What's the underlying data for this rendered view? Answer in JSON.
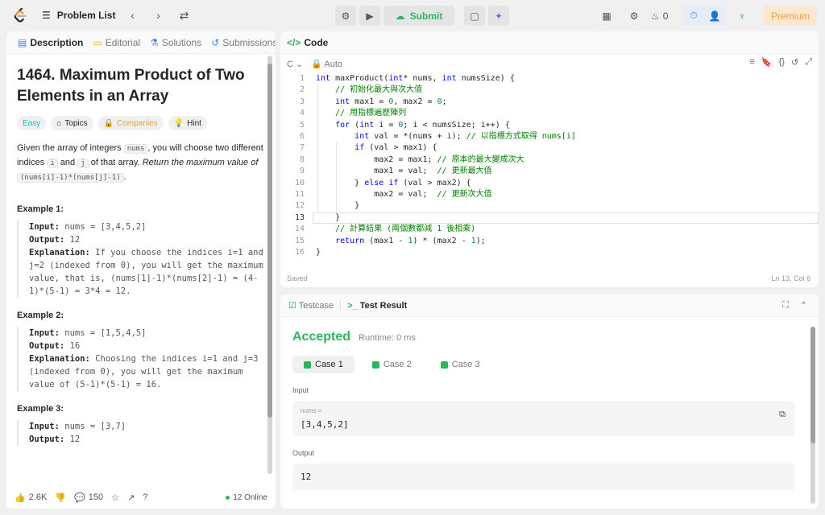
{
  "topbar": {
    "problem_list": "Problem List",
    "submit": "Submit",
    "streak": "0",
    "premium": "Premium"
  },
  "left": {
    "tabs": [
      "Description",
      "Editorial",
      "Solutions",
      "Submissions"
    ],
    "title": "1464. Maximum Product of Two Elements in an Array",
    "tags": {
      "easy": "Easy",
      "topics": "Topics",
      "companies": "Companies",
      "hint": "Hint"
    },
    "desc_p1": "Given the array of integers",
    "desc_code1": "nums",
    "desc_p2": ", you will choose two different indices",
    "desc_code2": "i",
    "desc_p3": "and",
    "desc_code3": "j",
    "desc_p4": "of that array.",
    "desc_em": "Return the maximum value of",
    "desc_code4": "(nums[i]-1)*(nums[j]-1)",
    "desc_end": ".",
    "examples": [
      {
        "h": "Example 1:",
        "input": "nums = [3,4,5,2]",
        "output": "12",
        "expl": "If you choose the indices i=1 and j=2 (indexed from 0), you will get the maximum value, that is, (nums[1]-1)*(nums[2]-1) = (4-1)*(5-1) = 3*4 = 12."
      },
      {
        "h": "Example 2:",
        "input": "nums = [1,5,4,5]",
        "output": "16",
        "expl": "Choosing the indices i=1 and j=3 (indexed from 0), you will get the maximum value of (5-1)*(5-1) = 16."
      },
      {
        "h": "Example 3:",
        "input": "nums = [3,7]",
        "output": "12"
      }
    ],
    "labels": {
      "input": "Input:",
      "output": "Output:",
      "expl": "Explanation:"
    },
    "footer": {
      "likes": "2.6K",
      "comments": "150",
      "online": "12 Online"
    }
  },
  "code": {
    "tab": "Code",
    "lang": "C",
    "auto": "Auto",
    "saved": "Saved",
    "pos": "Ln 13, Col 6",
    "line_numbers": [
      "1",
      "2",
      "3",
      "4",
      "5",
      "6",
      "7",
      "8",
      "9",
      "10",
      "11",
      "12",
      "13",
      "14",
      "15",
      "16"
    ]
  },
  "result": {
    "tab1": "Testcase",
    "tab2": "Test Result",
    "status": "Accepted",
    "runtime": "Runtime: 0 ms",
    "cases": [
      "Case 1",
      "Case 2",
      "Case 3"
    ],
    "input_label": "Input",
    "var": "nums =",
    "input_value": "[3,4,5,2]",
    "output_label": "Output",
    "output_value": "12"
  }
}
